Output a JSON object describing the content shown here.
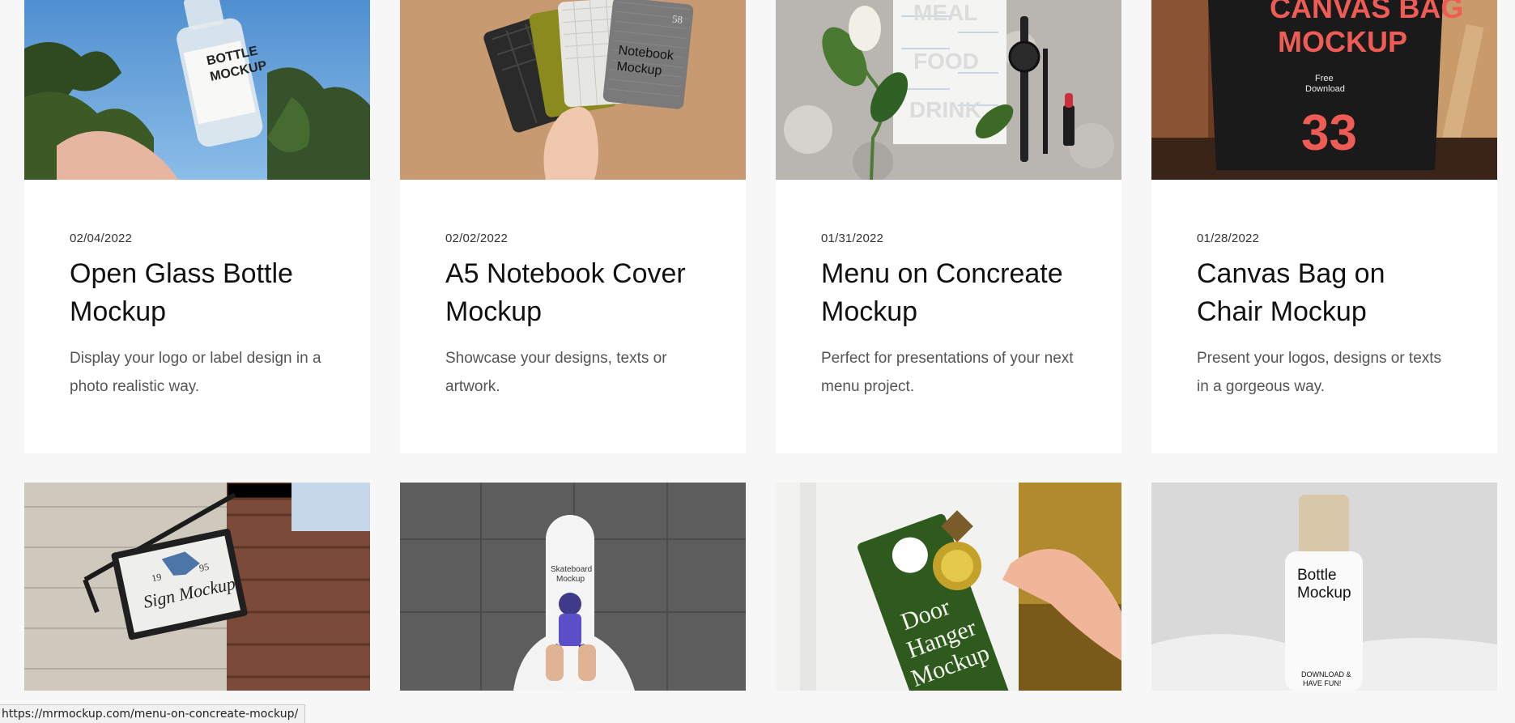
{
  "cards": [
    {
      "date": "02/04/2022",
      "title": "Open Glass Bottle Mockup",
      "description": "Display your logo or label design in a photo realistic way.",
      "image_text": [
        "BOTTLE",
        "MOCKUP"
      ]
    },
    {
      "date": "02/02/2022",
      "title": "A5 Notebook Cover Mockup",
      "description": "Showcase your designs, texts or artwork.",
      "image_text": [
        "Notebook",
        "Mockup",
        "58"
      ]
    },
    {
      "date": "01/31/2022",
      "title": "Menu on Concreate Mockup",
      "description": "Perfect for presentations of your next menu project.",
      "image_text": [
        "MEAL",
        "FOOD",
        "DRINK"
      ]
    },
    {
      "date": "01/28/2022",
      "title": "Canvas Bag on Chair Mockup",
      "description": "Present your logos, designs or texts in a gorgeous way.",
      "image_text": [
        "CANVAS BAG",
        "MOCKUP",
        "Free",
        "Download",
        "33"
      ]
    },
    {
      "image_text": [
        "Sign Mockup",
        "19",
        "95"
      ]
    },
    {
      "image_text": [
        "Skateboard",
        "Mockup"
      ]
    },
    {
      "image_text": [
        "Door",
        "Hanger",
        "Mockup"
      ]
    },
    {
      "image_text": [
        "Bottle",
        "Mockup",
        "DOWNLOAD &",
        "HAVE FUN!"
      ]
    }
  ],
  "status_bar": {
    "url": "https://mrmockup.com/menu-on-concreate-mockup/"
  }
}
